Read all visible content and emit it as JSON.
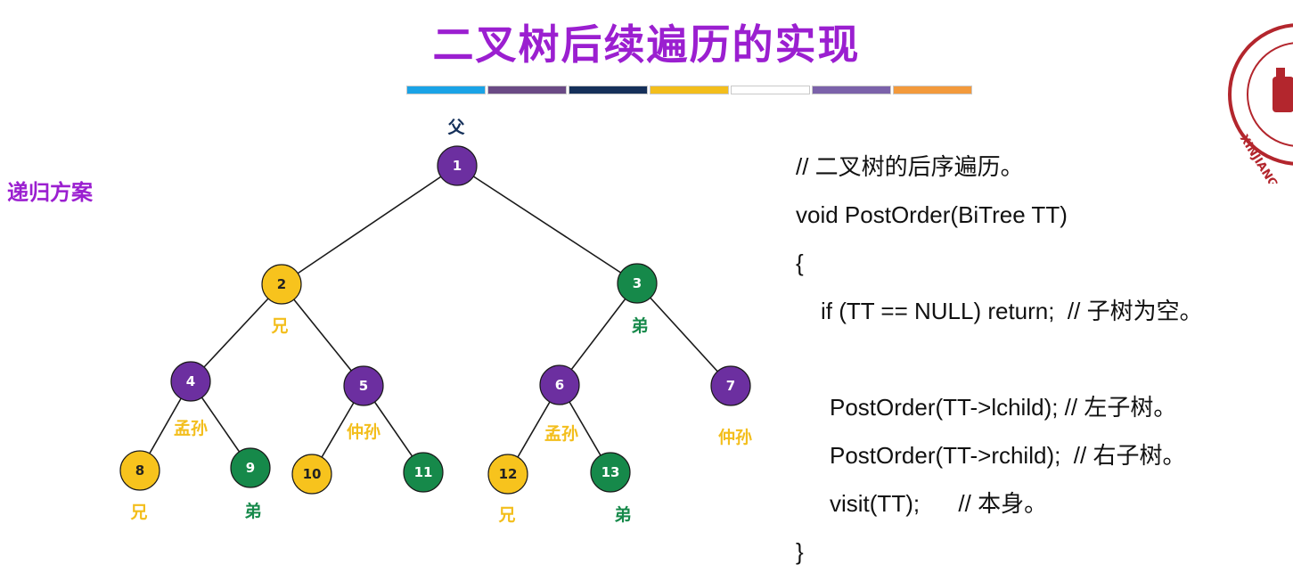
{
  "slide": {
    "title": "二叉树后续遍历的实现",
    "side_label": "递归方案",
    "color_bar": [
      "#1aa3e6",
      "#6a4a85",
      "#15305a",
      "#f3be1c",
      "#ffffff",
      "#7b62aa",
      "#f39a3c"
    ]
  },
  "tree": {
    "root_label": "父",
    "nodes": [
      {
        "id": "1",
        "color": "#6c2fa0"
      },
      {
        "id": "2",
        "color": "#f7c31d"
      },
      {
        "id": "3",
        "color": "#16894a"
      },
      {
        "id": "4",
        "color": "#6c2fa0"
      },
      {
        "id": "5",
        "color": "#6c2fa0"
      },
      {
        "id": "6",
        "color": "#6c2fa0"
      },
      {
        "id": "7",
        "color": "#6c2fa0"
      },
      {
        "id": "8",
        "color": "#f7c31d"
      },
      {
        "id": "9",
        "color": "#16894a"
      },
      {
        "id": "10",
        "color": "#f7c31d"
      },
      {
        "id": "11",
        "color": "#16894a"
      },
      {
        "id": "12",
        "color": "#f7c31d"
      },
      {
        "id": "13",
        "color": "#16894a"
      }
    ],
    "edges": [
      [
        "1",
        "2"
      ],
      [
        "1",
        "3"
      ],
      [
        "2",
        "4"
      ],
      [
        "2",
        "5"
      ],
      [
        "3",
        "6"
      ],
      [
        "3",
        "7"
      ],
      [
        "4",
        "8"
      ],
      [
        "4",
        "9"
      ],
      [
        "5",
        "10"
      ],
      [
        "5",
        "11"
      ],
      [
        "6",
        "12"
      ],
      [
        "6",
        "13"
      ]
    ],
    "relation_labels": [
      {
        "text": "兄",
        "color": "#f3be1c"
      },
      {
        "text": "弟",
        "color": "#16894a"
      },
      {
        "text": "孟孙",
        "color": "#f3be1c"
      },
      {
        "text": "仲孙",
        "color": "#f3be1c"
      },
      {
        "text": "孟孙",
        "color": "#f3be1c"
      },
      {
        "text": "仲孙",
        "color": "#f3be1c"
      },
      {
        "text": "兄",
        "color": "#f3be1c"
      },
      {
        "text": "弟",
        "color": "#16894a"
      },
      {
        "text": "兄",
        "color": "#f3be1c"
      },
      {
        "text": "弟",
        "color": "#16894a"
      }
    ]
  },
  "code": {
    "line1": "// 二叉树的后序遍历。",
    "line2": "void PostOrder(BiTree TT)",
    "line3": "{",
    "line4": "if (TT == NULL) return;  // 子树为空。",
    "line5": "PostOrder(TT->lchild); // 左子树。",
    "line6": "PostOrder(TT->rchild);  // 右子树。",
    "line7": "visit(TT);      // 本身。",
    "line8": "}"
  },
  "logo": {
    "text": "XINJIANG",
    "color": "#b3262d"
  }
}
